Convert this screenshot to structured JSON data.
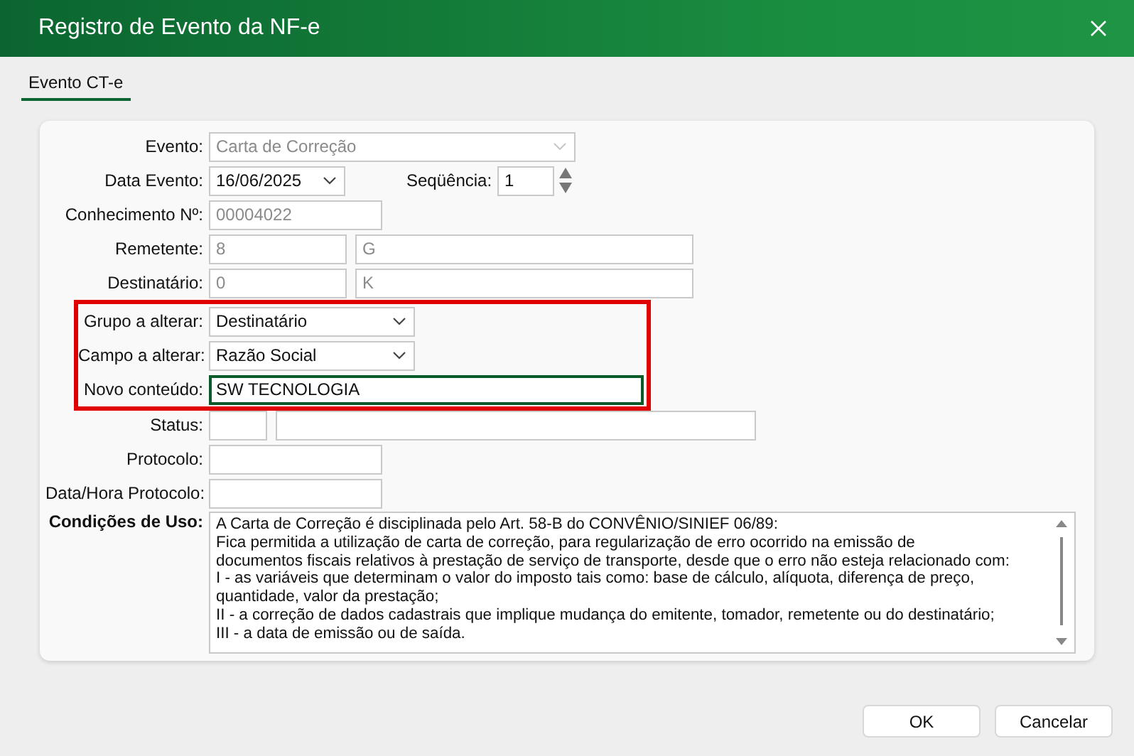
{
  "window": {
    "title": "Registro de Evento da NF-e"
  },
  "tabs": [
    {
      "label": "Evento CT-e",
      "selected": true
    }
  ],
  "form": {
    "rows_before": [
      {
        "label": "Evento:",
        "fields": [
          {
            "kind": "select",
            "value": "Carta de Correção",
            "disabled": true
          }
        ]
      },
      {
        "label": "Data Evento:",
        "fields": [
          {
            "kind": "select",
            "value": "16/06/2025",
            "disabled": false
          },
          {
            "kind": "label",
            "value": "Seqüência:"
          },
          {
            "kind": "spinner",
            "value": "1",
            "disabled": false
          }
        ]
      },
      {
        "label": "Conhecimento Nº:",
        "fields": [
          {
            "kind": "input",
            "value": "00004022",
            "disabled": true
          }
        ]
      },
      {
        "label": "Remetente:",
        "fields": [
          {
            "kind": "input",
            "value": "8",
            "disabled": true
          },
          {
            "kind": "input",
            "value": "G",
            "disabled": true
          }
        ]
      },
      {
        "label": "Destinatário:",
        "fields": [
          {
            "kind": "input",
            "value": "0",
            "disabled": true
          },
          {
            "kind": "input",
            "value": "K",
            "disabled": true
          }
        ]
      }
    ],
    "highlighted_rows": [
      {
        "label": "Grupo a alterar:",
        "fields": [
          {
            "kind": "select",
            "value": "Destinatário",
            "disabled": false
          }
        ]
      },
      {
        "label": "Campo a alterar:",
        "fields": [
          {
            "kind": "select",
            "value": "Razão Social",
            "disabled": false
          }
        ]
      },
      {
        "label": "Novo conteúdo:",
        "fields": [
          {
            "kind": "input",
            "value": "SW TECNOLOGIA",
            "disabled": false,
            "focused": true
          }
        ]
      }
    ],
    "rows_after": [
      {
        "label": "Status:",
        "fields": [
          {
            "kind": "input"
          },
          {
            "kind": "input"
          }
        ]
      },
      {
        "label": "Protocolo:",
        "fields": [
          {
            "kind": "input"
          }
        ]
      },
      {
        "label": "Data/Hora Protocolo:",
        "fields": [
          {
            "kind": "input"
          }
        ]
      }
    ],
    "terms": {
      "label": "Condições de Uso:",
      "text": "A Carta de Correção é disciplinada pelo Art. 58-B do CONVÊNIO/SINIEF 06/89:\nFica permitida a utilização de carta de correção, para regularização de erro ocorrido na emissão de\ndocumentos fiscais relativos à prestação de serviço de transporte, desde que o erro não esteja relacionado com:\nI - as variáveis que determinam o valor do imposto tais como: base de cálculo, alíquota, diferença de preço,\nquantidade, valor da prestação;\nII - a correção de dados cadastrais que implique mudança do emitente, tomador, remetente ou do destinatário;\nIII - a data de emissão ou de saída."
    }
  },
  "buttons": [
    "OK",
    "Cancelar"
  ]
}
